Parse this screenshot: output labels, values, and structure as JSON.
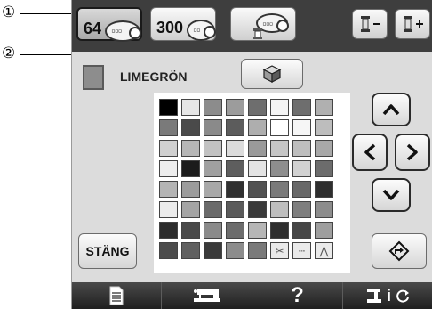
{
  "callouts": [
    "①",
    "②"
  ],
  "top_buttons": {
    "palette64": {
      "label": "64"
    },
    "palette300": {
      "label": "300"
    }
  },
  "current_color": {
    "name": "LIMEGRÖN",
    "color": "#8d8d8d"
  },
  "palette": {
    "rows": [
      [
        "#000000",
        "#e6e6e6",
        "#8c8c8c",
        "#9c9c9c",
        "#6e6e6e",
        "#f4f4f4",
        "#6e6e6e",
        "#b0b0b0"
      ],
      [
        "#7a7a7a",
        "#4a4a4a",
        "#8a8a8a",
        "#5c5c5c",
        "#aeaeae",
        "#ffffff",
        "#f6f6f6",
        "#bdbdbd"
      ],
      [
        "#d0d0d0",
        "#b6b6b6",
        "#c2c2c2",
        "#dcdcdc",
        "#9a9a9a",
        "#c6c6c6",
        "#bebebe",
        "#a8a8a8"
      ],
      [
        "#eeeeee",
        "#1c1c1c",
        "#a0a0a0",
        "#5e5e5e",
        "#e4e4e4",
        "#8e8e8e",
        "#d2d2d2",
        "#6c6c6c"
      ],
      [
        "#b4b4b4",
        "#9c9c9c",
        "#a8a8a8",
        "#303030",
        "#525252",
        "#7a7a7a",
        "#686868",
        "#2e2e2e"
      ],
      [
        "#ececec",
        "#a4a4a4",
        "#6a6a6a",
        "#5a5a5a",
        "#3a3a3a",
        "#bebebe",
        "#7e7e7e",
        "#8c8c8c"
      ],
      [
        "#2c2c2c",
        "#4a4a4a",
        "#8a8a8a",
        "#6c6c6c",
        "#b6b6b6",
        "#2e2e2e",
        "#464646",
        "#9e9e9e"
      ],
      [
        "#4c4c4c",
        "#606060",
        "#3a3a3a",
        "#8c8c8c",
        "#7a7a7a",
        "#c4c4c4",
        "#d6d6d6",
        "#ececec"
      ]
    ]
  },
  "buttons": {
    "close": "STÄNG"
  },
  "bottom": {
    "help": "?",
    "info": "i"
  }
}
